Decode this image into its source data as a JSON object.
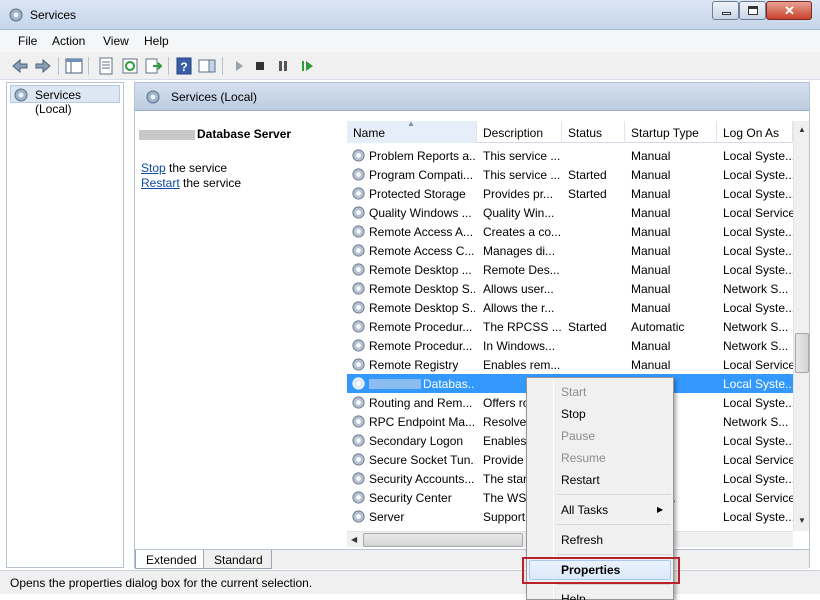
{
  "window": {
    "title": "Services"
  },
  "menu": [
    "File",
    "Action",
    "View",
    "Help"
  ],
  "tree": {
    "root_label": "Services (Local)"
  },
  "pane": {
    "header_title": "Services (Local)"
  },
  "detail": {
    "title_suffix": "Database Server",
    "stop_link": "Stop",
    "stop_rest": " the service",
    "restart_link": "Restart",
    "restart_rest": " the service"
  },
  "columns": [
    "Name",
    "Description",
    "Status",
    "Startup Type",
    "Log On As"
  ],
  "rows": [
    {
      "name": "Problem Reports a...",
      "desc": "This service ...",
      "status": "",
      "startup": "Manual",
      "logon": "Local Syste..."
    },
    {
      "name": "Program Compati...",
      "desc": "This service ...",
      "status": "Started",
      "startup": "Manual",
      "logon": "Local Syste..."
    },
    {
      "name": "Protected Storage",
      "desc": "Provides pr...",
      "status": "Started",
      "startup": "Manual",
      "logon": "Local Syste..."
    },
    {
      "name": "Quality Windows ...",
      "desc": "Quality Win...",
      "status": "",
      "startup": "Manual",
      "logon": "Local Service"
    },
    {
      "name": "Remote Access A...",
      "desc": "Creates a co...",
      "status": "",
      "startup": "Manual",
      "logon": "Local Syste..."
    },
    {
      "name": "Remote Access C...",
      "desc": "Manages di...",
      "status": "",
      "startup": "Manual",
      "logon": "Local Syste..."
    },
    {
      "name": "Remote Desktop ...",
      "desc": "Remote Des...",
      "status": "",
      "startup": "Manual",
      "logon": "Local Syste..."
    },
    {
      "name": "Remote Desktop S...",
      "desc": "Allows user...",
      "status": "",
      "startup": "Manual",
      "logon": "Network S..."
    },
    {
      "name": "Remote Desktop S...",
      "desc": "Allows the r...",
      "status": "",
      "startup": "Manual",
      "logon": "Local Syste..."
    },
    {
      "name": "Remote Procedur...",
      "desc": "The RPCSS ...",
      "status": "Started",
      "startup": "Automatic",
      "logon": "Network S..."
    },
    {
      "name": "Remote Procedur...",
      "desc": "In Windows...",
      "status": "",
      "startup": "Manual",
      "logon": "Network S..."
    },
    {
      "name": "Remote Registry",
      "desc": "Enables rem...",
      "status": "",
      "startup": "Manual",
      "logon": "Local Service"
    },
    {
      "name": "Databas...",
      "desc": "",
      "status": "",
      "startup": "atic",
      "logon": "Local Syste..."
    },
    {
      "name": "Routing and Rem...",
      "desc": "Offers ro",
      "status": "",
      "startup": "d",
      "logon": "Local Syste..."
    },
    {
      "name": "RPC Endpoint Ma...",
      "desc": "Resolves",
      "status": "",
      "startup": "atic",
      "logon": "Network S..."
    },
    {
      "name": "Secondary Logon",
      "desc": "Enables",
      "status": "",
      "startup": "",
      "logon": "Local Syste..."
    },
    {
      "name": "Secure Socket Tun...",
      "desc": "Provide",
      "status": "",
      "startup": "",
      "logon": "Local Service"
    },
    {
      "name": "Security Accounts...",
      "desc": "The star",
      "status": "",
      "startup": "atic",
      "logon": "Local Syste..."
    },
    {
      "name": "Security Center",
      "desc": "The WSC",
      "status": "",
      "startup": "atic (D...",
      "logon": "Local Service"
    },
    {
      "name": "Server",
      "desc": "Support",
      "status": "",
      "startup": "atic",
      "logon": "Local Syste..."
    }
  ],
  "tabs": [
    "Extended",
    "Standard"
  ],
  "status_bar": "Opens the properties dialog box for the current selection.",
  "context_menu": {
    "start": "Start",
    "stop": "Stop",
    "pause": "Pause",
    "resume": "Resume",
    "restart": "Restart",
    "all_tasks": "All Tasks",
    "refresh": "Refresh",
    "properties": "Properties",
    "help": "Help"
  },
  "icons": {
    "app": "services-gear-icon",
    "back": "back-arrow-icon",
    "forward": "forward-arrow-icon",
    "play": "play-icon",
    "stop": "stop-icon",
    "pause": "pause-icon",
    "restart": "restart-icon"
  },
  "colors": {
    "selection": "#3399ff",
    "highlight_box": "#b8232b",
    "link": "#0d4aa6"
  }
}
